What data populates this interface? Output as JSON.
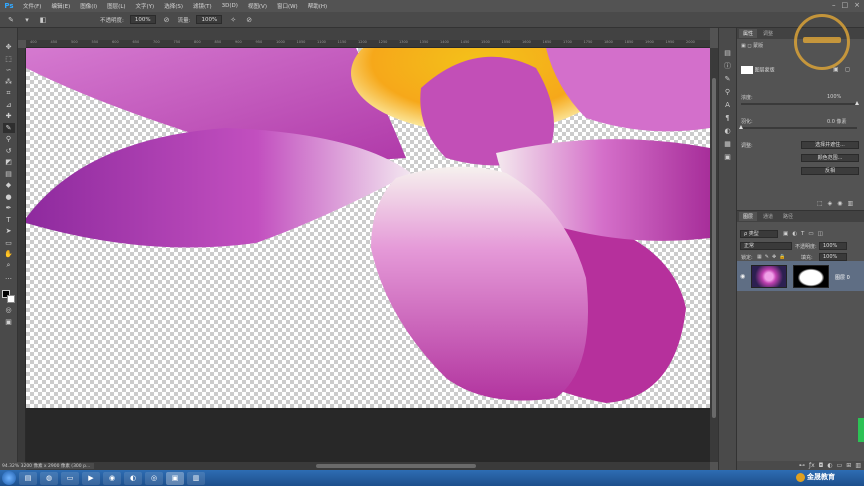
{
  "app": {
    "logo": "Ps"
  },
  "menu": [
    "文件(F)",
    "编辑(E)",
    "图像(I)",
    "图层(L)",
    "文字(Y)",
    "选择(S)",
    "滤镜(T)",
    "3D(D)",
    "视图(V)",
    "窗口(W)",
    "帮助(H)"
  ],
  "options_bar": {
    "opacity_label": "不透明度:",
    "opacity_value": "100%",
    "flow_label": "流量:",
    "flow_value": "100%"
  },
  "ruler_ticks": [
    "400",
    "450",
    "500",
    "550",
    "600",
    "650",
    "700",
    "750",
    "800",
    "850",
    "900",
    "950",
    "1000",
    "1050",
    "1100",
    "1150",
    "1200",
    "1250",
    "1300",
    "1350",
    "1400",
    "1450",
    "1500",
    "1550",
    "1600",
    "1650",
    "1700",
    "1750",
    "1800",
    "1850",
    "1900",
    "1950",
    "2000"
  ],
  "status": {
    "text": "94.32%    3200 像素 x 2900 像素 (300 p..."
  },
  "properties": {
    "tabs": [
      "属性",
      "调整"
    ],
    "header_label": "蒙版",
    "layer_mask_label": "图层蒙版",
    "density_label": "浓度:",
    "density_value": "100%",
    "density_fraction": 1.0,
    "feather_label": "羽化:",
    "feather_value": "0.0 像素",
    "feather_fraction": 0.0,
    "adjust_label": "调整:",
    "buttons": [
      "选择并遮住...",
      "颜色范围...",
      "反相"
    ]
  },
  "layers": {
    "tabs": [
      "图层",
      "通道",
      "路径"
    ],
    "filter_label": "ρ 类型",
    "blend_mode": "正常",
    "opacity_label": "不透明度:",
    "opacity_value": "100%",
    "lock_label": "锁定:",
    "fill_label": "填充:",
    "fill_value": "100%",
    "layer_name": "图层 0"
  },
  "brand": {
    "text": "金晟教育"
  }
}
